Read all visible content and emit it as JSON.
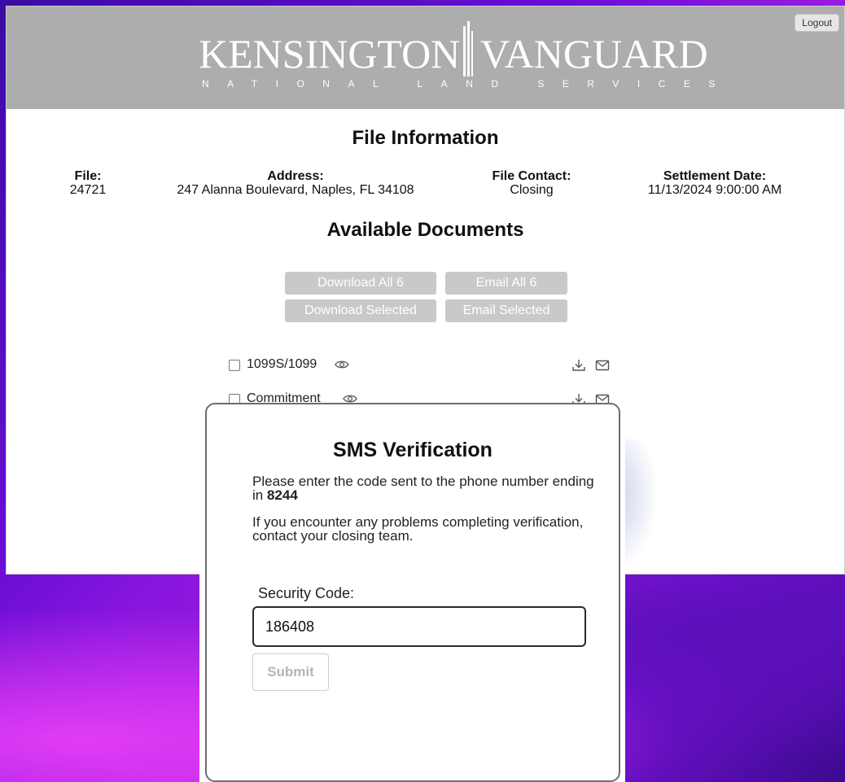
{
  "header": {
    "logo_left": "KENSINGTON",
    "logo_right": "VANGUARD",
    "logo_sub": "NATIONAL LAND SERVICES",
    "logout_label": "Logout"
  },
  "file_info": {
    "title": "File Information",
    "file_label": "File:",
    "file_value": "24721",
    "address_label": "Address:",
    "address_value": "247 Alanna Boulevard, Naples, FL 34108",
    "contact_label": "File Contact:",
    "contact_value": "Closing",
    "settlement_label": "Settlement Date:",
    "settlement_value": "11/13/2024 9:00:00 AM"
  },
  "documents": {
    "title": "Available Documents",
    "download_all": "Download All 6",
    "email_all": "Email All 6",
    "download_selected": "Download Selected",
    "email_selected": "Email Selected",
    "items": [
      {
        "name": "1099S/1099"
      },
      {
        "name": "Commitment"
      }
    ]
  },
  "modal": {
    "title": "SMS Verification",
    "line1_prefix": "Please enter the code sent to the phone number ending in ",
    "phone_suffix": "8244",
    "line2": "If you encounter any problems completing verification, contact your closing team.",
    "code_label": "Security Code:",
    "code_value": "186408",
    "submit_label": "Submit"
  },
  "colors": {
    "header_bg": "#adadad",
    "button_disabled": "#c9c9c9",
    "bg_gradient_start": "#3a0ca3",
    "bg_gradient_mid": "#b021e8"
  }
}
